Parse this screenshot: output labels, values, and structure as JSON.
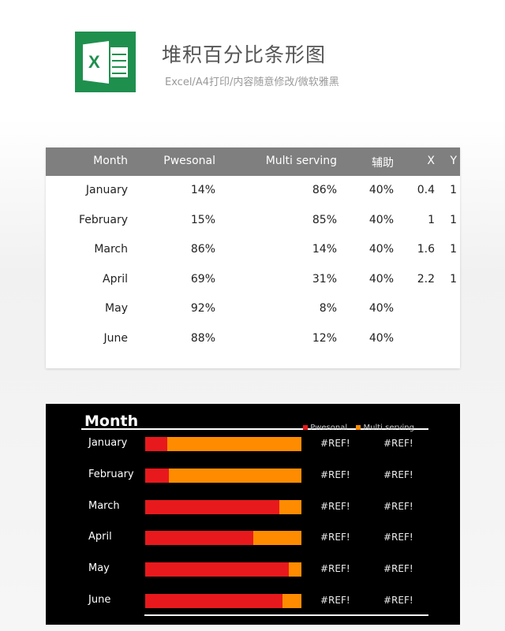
{
  "header": {
    "title": "堆积百分比条形图",
    "subtitle": "Excel/A4打印/内容随意修改/微软雅黑",
    "logo_letter": "X"
  },
  "table": {
    "columns": [
      "Month",
      "Pwesonal",
      "Multi serving",
      "辅助",
      "X",
      "Y"
    ],
    "rows": [
      [
        "January",
        "14%",
        "86%",
        "40%",
        "0.4",
        "1"
      ],
      [
        "February",
        "15%",
        "85%",
        "40%",
        "1",
        "1"
      ],
      [
        "March",
        "86%",
        "14%",
        "40%",
        "1.6",
        "1"
      ],
      [
        "April",
        "69%",
        "31%",
        "40%",
        "2.2",
        "1"
      ],
      [
        "May",
        "92%",
        "8%",
        "40%",
        "",
        ""
      ],
      [
        "June",
        "88%",
        "12%",
        "40%",
        "",
        ""
      ]
    ]
  },
  "chart_data": {
    "type": "bar",
    "stacked_percent": true,
    "title": "Month",
    "categories": [
      "January",
      "February",
      "March",
      "April",
      "May",
      "June"
    ],
    "series": [
      {
        "name": "Pwesonal",
        "color": "#e8191c",
        "values": [
          14,
          15,
          86,
          69,
          92,
          88
        ]
      },
      {
        "name": "Multi serving",
        "color": "#ff8c00",
        "values": [
          86,
          85,
          14,
          31,
          8,
          12
        ]
      }
    ],
    "legend": "top-right",
    "xlim": [
      0,
      100
    ],
    "data_labels": [
      "#REF!",
      "#REF!"
    ],
    "background": "#000000"
  }
}
